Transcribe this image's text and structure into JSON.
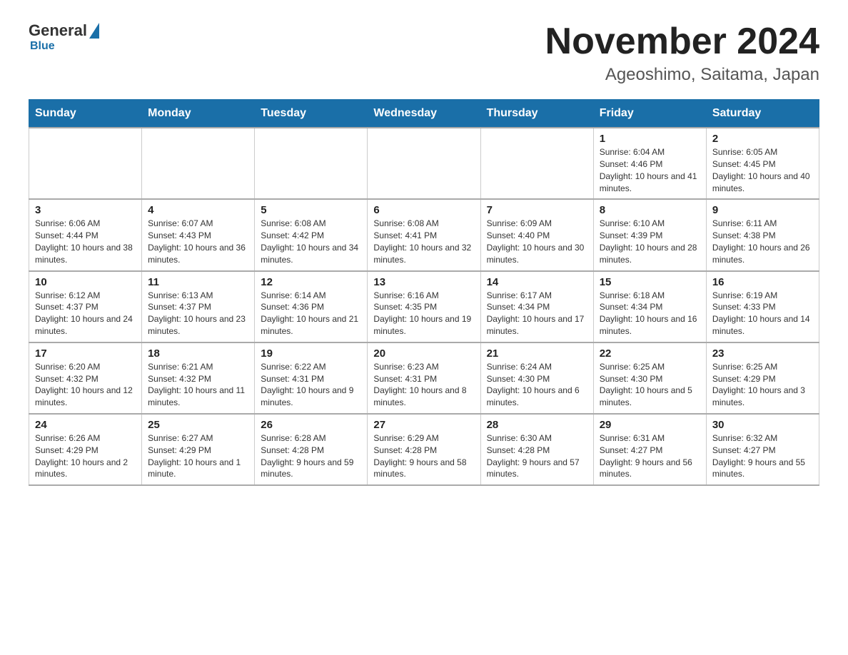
{
  "header": {
    "logo": {
      "general": "General",
      "blue": "Blue"
    },
    "title": "November 2024",
    "subtitle": "Ageoshimo, Saitama, Japan"
  },
  "weekdays": [
    "Sunday",
    "Monday",
    "Tuesday",
    "Wednesday",
    "Thursday",
    "Friday",
    "Saturday"
  ],
  "weeks": [
    [
      {
        "day": "",
        "info": ""
      },
      {
        "day": "",
        "info": ""
      },
      {
        "day": "",
        "info": ""
      },
      {
        "day": "",
        "info": ""
      },
      {
        "day": "",
        "info": ""
      },
      {
        "day": "1",
        "info": "Sunrise: 6:04 AM\nSunset: 4:46 PM\nDaylight: 10 hours and 41 minutes."
      },
      {
        "day": "2",
        "info": "Sunrise: 6:05 AM\nSunset: 4:45 PM\nDaylight: 10 hours and 40 minutes."
      }
    ],
    [
      {
        "day": "3",
        "info": "Sunrise: 6:06 AM\nSunset: 4:44 PM\nDaylight: 10 hours and 38 minutes."
      },
      {
        "day": "4",
        "info": "Sunrise: 6:07 AM\nSunset: 4:43 PM\nDaylight: 10 hours and 36 minutes."
      },
      {
        "day": "5",
        "info": "Sunrise: 6:08 AM\nSunset: 4:42 PM\nDaylight: 10 hours and 34 minutes."
      },
      {
        "day": "6",
        "info": "Sunrise: 6:08 AM\nSunset: 4:41 PM\nDaylight: 10 hours and 32 minutes."
      },
      {
        "day": "7",
        "info": "Sunrise: 6:09 AM\nSunset: 4:40 PM\nDaylight: 10 hours and 30 minutes."
      },
      {
        "day": "8",
        "info": "Sunrise: 6:10 AM\nSunset: 4:39 PM\nDaylight: 10 hours and 28 minutes."
      },
      {
        "day": "9",
        "info": "Sunrise: 6:11 AM\nSunset: 4:38 PM\nDaylight: 10 hours and 26 minutes."
      }
    ],
    [
      {
        "day": "10",
        "info": "Sunrise: 6:12 AM\nSunset: 4:37 PM\nDaylight: 10 hours and 24 minutes."
      },
      {
        "day": "11",
        "info": "Sunrise: 6:13 AM\nSunset: 4:37 PM\nDaylight: 10 hours and 23 minutes."
      },
      {
        "day": "12",
        "info": "Sunrise: 6:14 AM\nSunset: 4:36 PM\nDaylight: 10 hours and 21 minutes."
      },
      {
        "day": "13",
        "info": "Sunrise: 6:16 AM\nSunset: 4:35 PM\nDaylight: 10 hours and 19 minutes."
      },
      {
        "day": "14",
        "info": "Sunrise: 6:17 AM\nSunset: 4:34 PM\nDaylight: 10 hours and 17 minutes."
      },
      {
        "day": "15",
        "info": "Sunrise: 6:18 AM\nSunset: 4:34 PM\nDaylight: 10 hours and 16 minutes."
      },
      {
        "day": "16",
        "info": "Sunrise: 6:19 AM\nSunset: 4:33 PM\nDaylight: 10 hours and 14 minutes."
      }
    ],
    [
      {
        "day": "17",
        "info": "Sunrise: 6:20 AM\nSunset: 4:32 PM\nDaylight: 10 hours and 12 minutes."
      },
      {
        "day": "18",
        "info": "Sunrise: 6:21 AM\nSunset: 4:32 PM\nDaylight: 10 hours and 11 minutes."
      },
      {
        "day": "19",
        "info": "Sunrise: 6:22 AM\nSunset: 4:31 PM\nDaylight: 10 hours and 9 minutes."
      },
      {
        "day": "20",
        "info": "Sunrise: 6:23 AM\nSunset: 4:31 PM\nDaylight: 10 hours and 8 minutes."
      },
      {
        "day": "21",
        "info": "Sunrise: 6:24 AM\nSunset: 4:30 PM\nDaylight: 10 hours and 6 minutes."
      },
      {
        "day": "22",
        "info": "Sunrise: 6:25 AM\nSunset: 4:30 PM\nDaylight: 10 hours and 5 minutes."
      },
      {
        "day": "23",
        "info": "Sunrise: 6:25 AM\nSunset: 4:29 PM\nDaylight: 10 hours and 3 minutes."
      }
    ],
    [
      {
        "day": "24",
        "info": "Sunrise: 6:26 AM\nSunset: 4:29 PM\nDaylight: 10 hours and 2 minutes."
      },
      {
        "day": "25",
        "info": "Sunrise: 6:27 AM\nSunset: 4:29 PM\nDaylight: 10 hours and 1 minute."
      },
      {
        "day": "26",
        "info": "Sunrise: 6:28 AM\nSunset: 4:28 PM\nDaylight: 9 hours and 59 minutes."
      },
      {
        "day": "27",
        "info": "Sunrise: 6:29 AM\nSunset: 4:28 PM\nDaylight: 9 hours and 58 minutes."
      },
      {
        "day": "28",
        "info": "Sunrise: 6:30 AM\nSunset: 4:28 PM\nDaylight: 9 hours and 57 minutes."
      },
      {
        "day": "29",
        "info": "Sunrise: 6:31 AM\nSunset: 4:27 PM\nDaylight: 9 hours and 56 minutes."
      },
      {
        "day": "30",
        "info": "Sunrise: 6:32 AM\nSunset: 4:27 PM\nDaylight: 9 hours and 55 minutes."
      }
    ]
  ]
}
